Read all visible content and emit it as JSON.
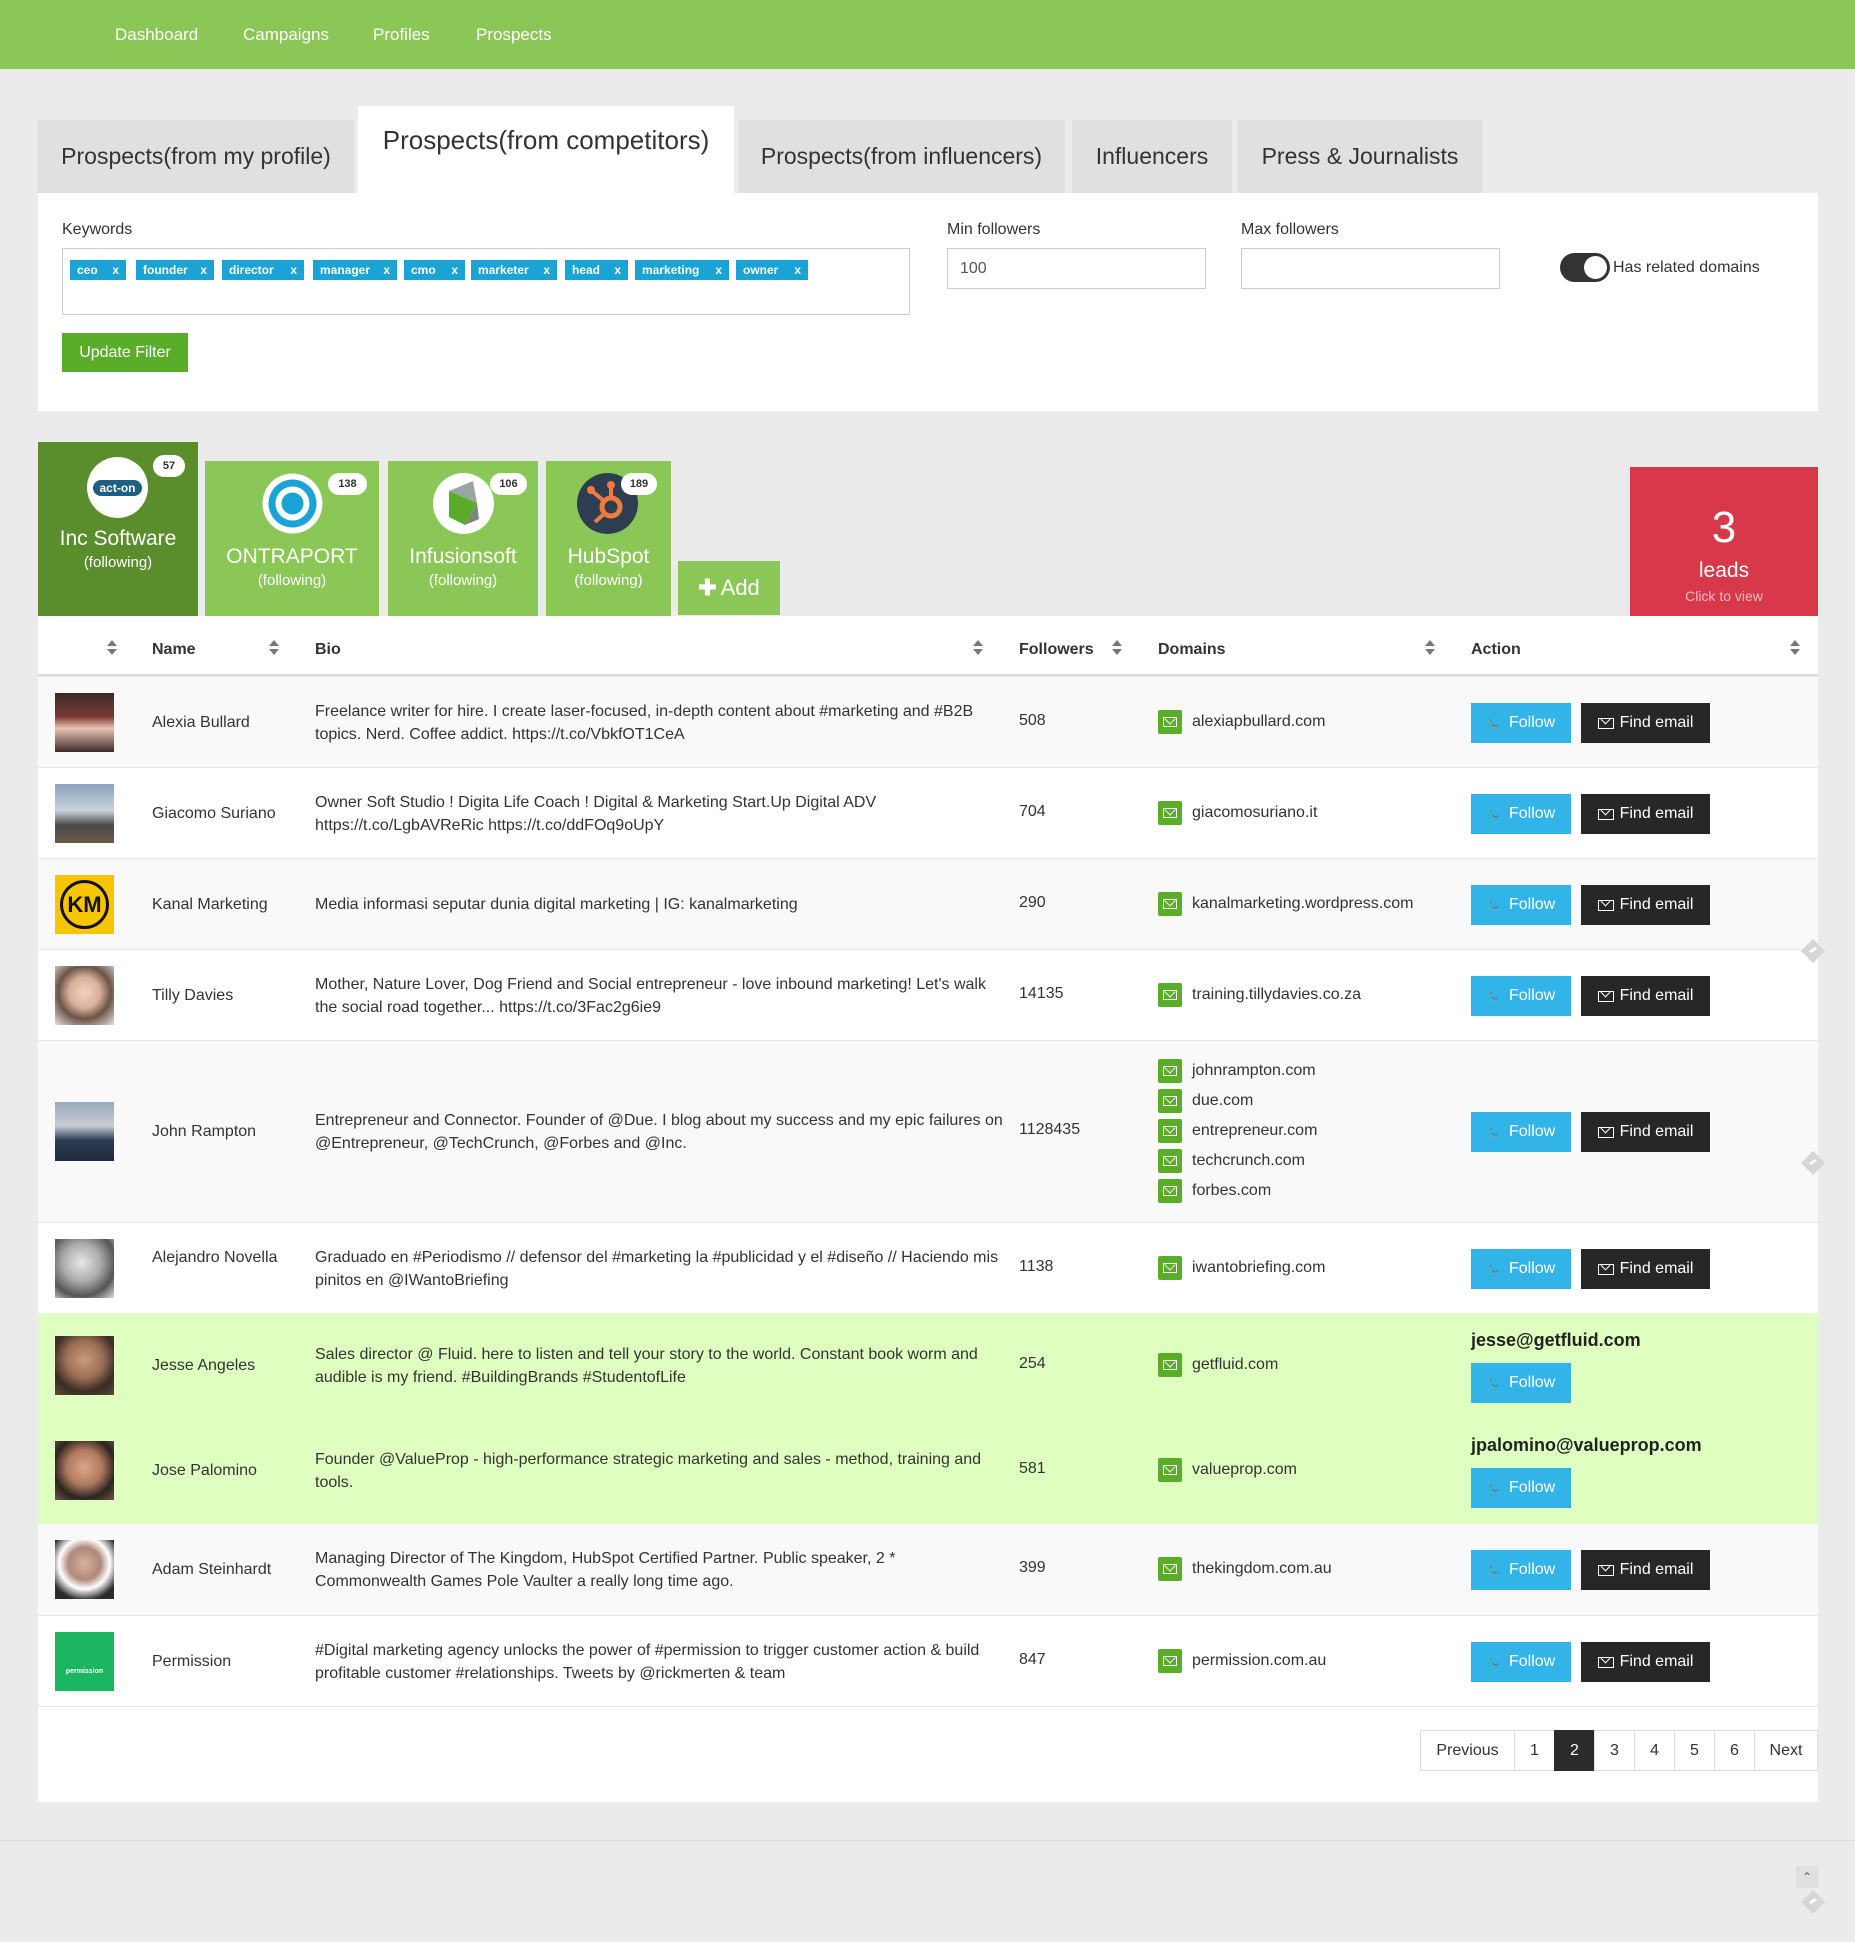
{
  "nav": {
    "items": [
      "Dashboard",
      "Campaigns",
      "Profiles",
      "Prospects"
    ]
  },
  "tabs": [
    "Prospects(from my profile)",
    "Prospects(from competitors)",
    "Prospects(from influencers)",
    "Influencers",
    "Press & Journalists"
  ],
  "active_tab": "Prospects(from competitors)",
  "filter": {
    "keywords_label": "Keywords",
    "keywords": [
      "ceo",
      "founder",
      "director",
      "manager",
      "cmo",
      "marketer",
      "head",
      "marketing",
      "owner"
    ],
    "tag_remove": "x",
    "min_label": "Min followers",
    "min_value": "100",
    "max_label": "Max followers",
    "max_value": "",
    "related_label": "Has related domains",
    "related_enabled": true,
    "update_label": "Update Filter"
  },
  "competitors": [
    {
      "name": "Inc Software",
      "status": "(following)",
      "count": "57",
      "logo_text": "act-on",
      "selected": true
    },
    {
      "name": "ONTRAPORT",
      "status": "(following)",
      "count": "138",
      "selected": false
    },
    {
      "name": "Infusionsoft",
      "status": "(following)",
      "count": "106",
      "selected": false
    },
    {
      "name": "HubSpot",
      "status": "(following)",
      "count": "189",
      "selected": false
    }
  ],
  "add_label": "Add",
  "leads": {
    "count": "3",
    "label": "leads",
    "sub": "Click to view"
  },
  "table": {
    "headers": {
      "name": "Name",
      "bio": "Bio",
      "followers": "Followers",
      "domains": "Domains",
      "action": "Action"
    },
    "follow_label": "Follow",
    "find_email_label": "Find email",
    "rows": [
      {
        "name": "Alexia Bullard",
        "bio": "Freelance writer for hire. I create laser-focused, in-depth content about #marketing and #B2B topics. Nerd. Coffee addict. https://t.co/VbkfOT1CeA",
        "followers": "508",
        "domains": [
          "alexiapbullard.com"
        ]
      },
      {
        "name": "Giacomo Suriano",
        "bio": "Owner Soft Studio ! Digita Life Coach ! Digital & Marketing Start.Up Digital ADV https://t.co/LgbAVReRic https://t.co/ddFOq9oUpY",
        "followers": "704",
        "domains": [
          "giacomosuriano.it"
        ]
      },
      {
        "name": "Kanal Marketing",
        "bio": "Media informasi seputar dunia digital marketing | IG: kanalmarketing",
        "followers": "290",
        "domains": [
          "kanalmarketing.wordpress.com"
        ],
        "avatar_text": "KM"
      },
      {
        "name": "Tilly Davies",
        "bio": "Mother, Nature Lover, Dog Friend and Social entrepreneur - love inbound marketing! Let's walk the social road together... https://t.co/3Fac2g6ie9",
        "followers": "14135",
        "domains": [
          "training.tillydavies.co.za"
        ]
      },
      {
        "name": "John Rampton",
        "bio": "Entrepreneur and Connector. Founder of @Due. I blog about my success and my epic failures on @Entrepreneur, @TechCrunch, @Forbes and @Inc.",
        "followers": "1128435",
        "domains": [
          "johnrampton.com",
          "due.com",
          "entrepreneur.com",
          "techcrunch.com",
          "forbes.com"
        ]
      },
      {
        "name": "Alejandro Novella",
        "bio": "Graduado en #Periodismo // defensor del #marketing la #publicidad y el #diseño // Haciendo mis pinitos en @IWantoBriefing",
        "followers": "1138",
        "domains": [
          "iwantobriefing.com"
        ]
      },
      {
        "name": "Jesse Angeles",
        "bio": "Sales director @ Fluid. here to listen and tell your story to the world. Constant book worm and audible is my friend. #BuildingBrands #StudentofLife",
        "followers": "254",
        "domains": [
          "getfluid.com"
        ],
        "email": "jesse@getfluid.com"
      },
      {
        "name": "Jose Palomino",
        "bio": "Founder @ValueProp - high-performance strategic marketing and sales - method, training and tools.",
        "followers": "581",
        "domains": [
          "valueprop.com"
        ],
        "email": "jpalomino@valueprop.com"
      },
      {
        "name": "Adam Steinhardt",
        "bio": "Managing Director of The Kingdom, HubSpot Certified Partner. Public speaker, 2 * Commonwealth Games Pole Vaulter a really long time ago.",
        "followers": "399",
        "domains": [
          "thekingdom.com.au"
        ]
      },
      {
        "name": "Permission",
        "bio": "#Digital marketing agency unlocks the power of #permission to trigger customer action & build profitable customer #relationships. Tweets by @rickmerten & team",
        "followers": "847",
        "domains": [
          "permission.com.au"
        ],
        "avatar_text": "permission"
      }
    ]
  },
  "pagination": {
    "items": [
      "Previous",
      "1",
      "2",
      "3",
      "4",
      "5",
      "6",
      "Next"
    ],
    "current": "2"
  },
  "colors": {
    "brand_green": "#8bc756",
    "button_green": "#5aad29",
    "twitter_blue": "#33b4e8",
    "leads_red": "#d8394a",
    "highlight_row": "#dfffc0"
  }
}
